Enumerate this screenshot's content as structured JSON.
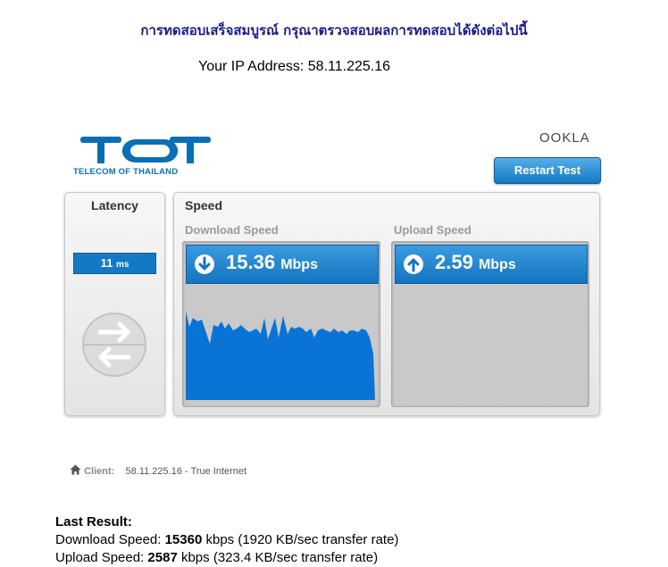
{
  "header": {
    "thai_message": "การทดสอบเสร็จสมบูรณ์ กรุณาตรวจสอบผลการทดสอบได้ดังต่อไปนี้",
    "ip_label": "Your IP Address:",
    "ip_value": "58.11.225.16"
  },
  "widget": {
    "provider_logo_text": "TOT",
    "provider_tagline": "TELECOM OF THAILAND",
    "ookla_logo_text": "OOKLA",
    "restart_button_label": "Restart Test",
    "latency": {
      "title": "Latency",
      "value": "11",
      "unit": "ms"
    },
    "speed": {
      "title": "Speed",
      "download": {
        "label": "Download Speed",
        "value": "15.36",
        "unit": "Mbps"
      },
      "upload": {
        "label": "Upload Speed",
        "value": "2.59",
        "unit": "Mbps"
      }
    },
    "colors": {
      "accent": "#1379c6",
      "graph_fill": "#0a74d6",
      "heading": "#1a1a8c"
    }
  },
  "client": {
    "label": "Client:",
    "value": "58.11.225.16 - True Internet",
    "icon": "home-icon"
  },
  "last_result": {
    "title": "Last Result:",
    "download_prefix": "Download Speed:",
    "download_kbps": "15360",
    "download_suffix": "kbps (1920 KB/sec transfer rate)",
    "upload_prefix": "Upload Speed:",
    "upload_kbps": "2587",
    "upload_suffix": "kbps (323.4 KB/sec transfer rate)"
  }
}
